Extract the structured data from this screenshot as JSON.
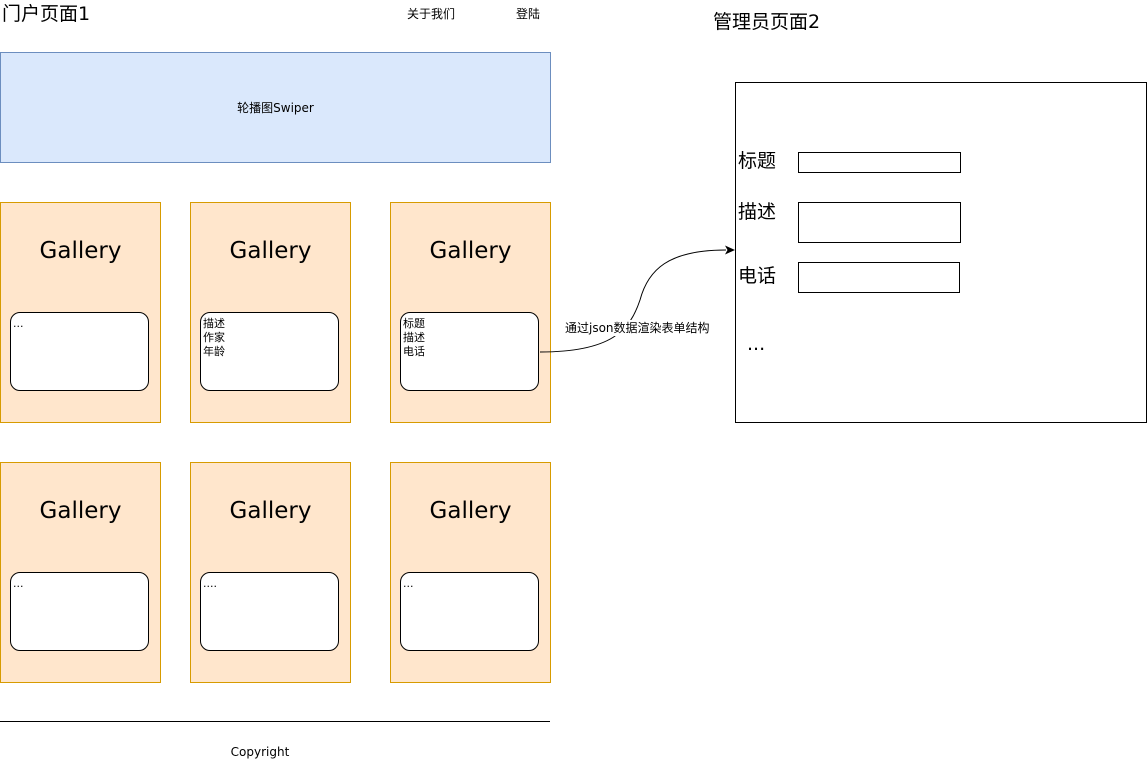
{
  "portal": {
    "title": "门户页面1",
    "nav": {
      "about": "关于我们",
      "login": "登陆"
    },
    "swiper_label": "轮播图Swiper",
    "galleries": [
      {
        "title": "Gallery",
        "lines": [
          "..."
        ]
      },
      {
        "title": "Gallery",
        "lines": [
          "描述",
          "作家",
          "年龄"
        ]
      },
      {
        "title": "Gallery",
        "lines": [
          "标题",
          "描述",
          "电话"
        ]
      },
      {
        "title": "Gallery",
        "lines": [
          "..."
        ]
      },
      {
        "title": "Gallery",
        "lines": [
          "...."
        ]
      },
      {
        "title": "Gallery",
        "lines": [
          "..."
        ]
      }
    ],
    "footer": "Copyright"
  },
  "admin": {
    "title": "管理员页面2",
    "fields": [
      {
        "label": "标题"
      },
      {
        "label": "描述"
      },
      {
        "label": "电话"
      }
    ],
    "more": "..."
  },
  "connector": {
    "label": "通过json数据渲染表单结构"
  },
  "colors": {
    "swiper_fill": "#dae8fc",
    "swiper_stroke": "#6c8ebf",
    "gallery_fill": "#ffe6cc",
    "gallery_stroke": "#d79b00"
  }
}
